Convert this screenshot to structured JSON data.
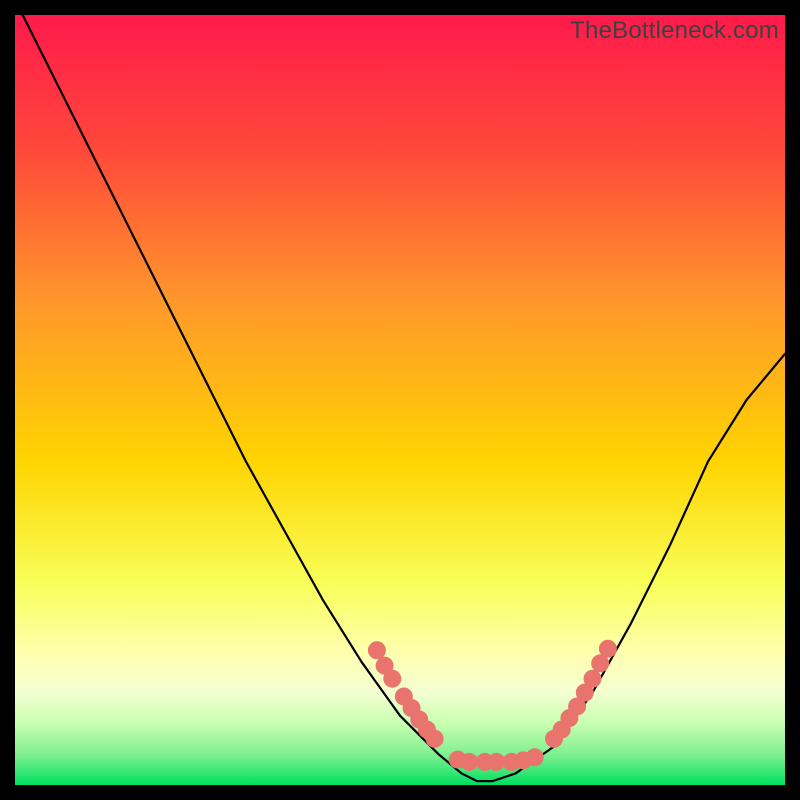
{
  "watermark": "TheBottleneck.com",
  "chart_data": {
    "type": "line",
    "title": "",
    "xlabel": "",
    "ylabel": "",
    "xlim": [
      0,
      100
    ],
    "ylim": [
      0,
      100
    ],
    "gradient_colors": {
      "top": "#ff1a4b",
      "mid_upper": "#ff7a2a",
      "mid": "#ffd400",
      "mid_lower": "#f8ff5a",
      "band_pale_yellow": "#ffffb0",
      "band_pale_green": "#d8ffc0",
      "bottom": "#00e060"
    },
    "curve": {
      "description": "Asymmetric V-shaped bottleneck curve; steep left descent, flat trough, moderate right ascent.",
      "x": [
        0,
        5,
        10,
        15,
        20,
        25,
        30,
        35,
        40,
        45,
        50,
        55,
        58,
        60,
        62,
        65,
        70,
        75,
        80,
        85,
        90,
        95,
        100
      ],
      "y": [
        102,
        92,
        82,
        72,
        62,
        52,
        42,
        33,
        24,
        16,
        9,
        4,
        1.5,
        0.5,
        0.5,
        1.5,
        5,
        12,
        21,
        31,
        42,
        50,
        56
      ]
    },
    "markers": {
      "description": "Two clusters of salmon-pink dots near the curve's flanks just above the trough.",
      "color": "#e9746e",
      "radius_px": 9,
      "points": [
        {
          "x": 47,
          "y": 17.5
        },
        {
          "x": 48,
          "y": 15.5
        },
        {
          "x": 49,
          "y": 13.8
        },
        {
          "x": 50.5,
          "y": 11.5
        },
        {
          "x": 51.5,
          "y": 10.0
        },
        {
          "x": 52.5,
          "y": 8.5
        },
        {
          "x": 53.5,
          "y": 7.2
        },
        {
          "x": 54.5,
          "y": 6.0
        },
        {
          "x": 57.5,
          "y": 3.3
        },
        {
          "x": 59,
          "y": 3.0
        },
        {
          "x": 61,
          "y": 3.0
        },
        {
          "x": 62.5,
          "y": 3.0
        },
        {
          "x": 64.5,
          "y": 3.0
        },
        {
          "x": 66,
          "y": 3.2
        },
        {
          "x": 67.5,
          "y": 3.6
        },
        {
          "x": 70,
          "y": 6.0
        },
        {
          "x": 71,
          "y": 7.2
        },
        {
          "x": 72,
          "y": 8.7
        },
        {
          "x": 73,
          "y": 10.2
        },
        {
          "x": 74,
          "y": 12.0
        },
        {
          "x": 75,
          "y": 13.8
        },
        {
          "x": 76,
          "y": 15.8
        },
        {
          "x": 77,
          "y": 17.7
        }
      ]
    }
  }
}
